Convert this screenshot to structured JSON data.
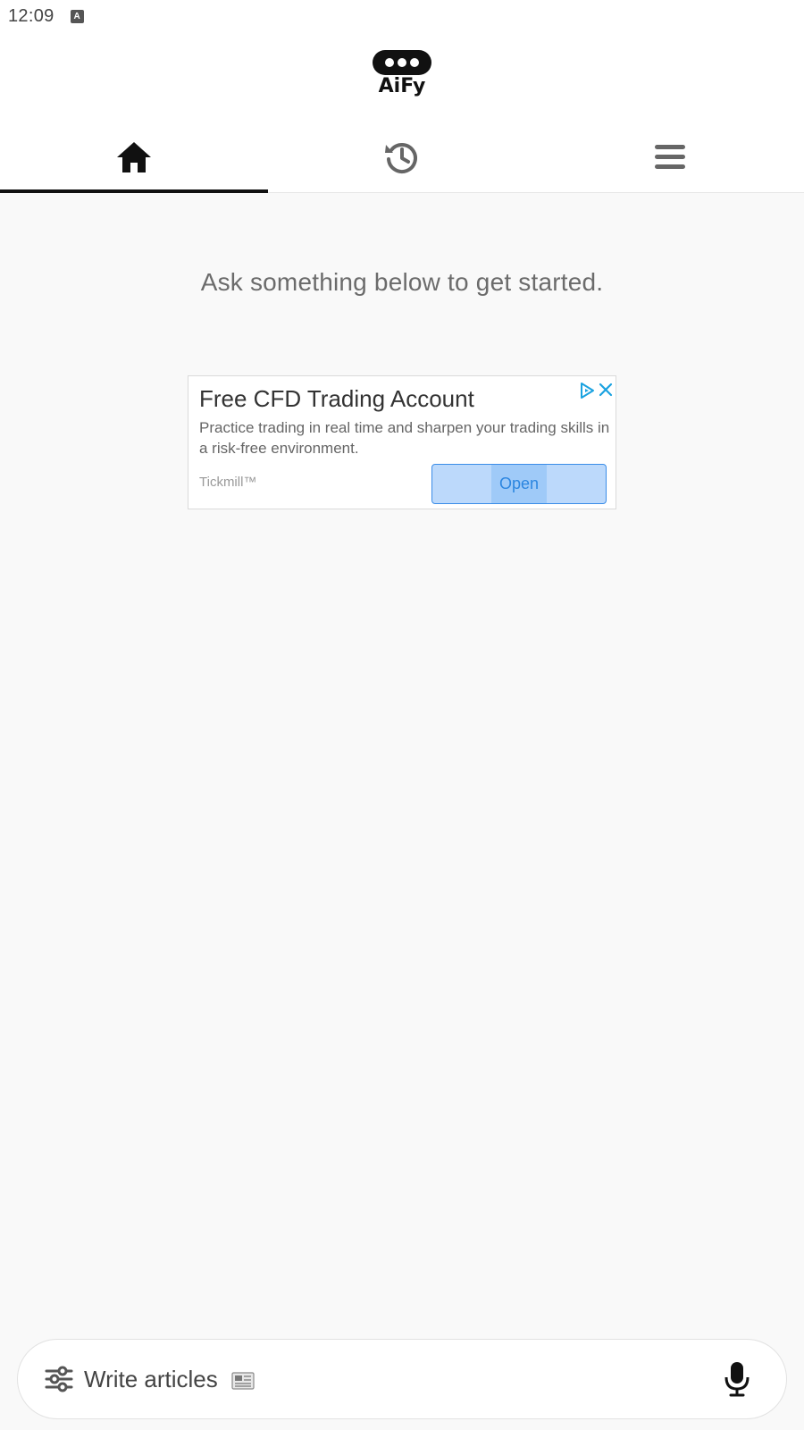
{
  "status_bar": {
    "time": "12:09",
    "notification_icon": "text-a-icon"
  },
  "header": {
    "logo_text": "AiFy",
    "tabs": [
      {
        "id": "home",
        "icon": "home-icon",
        "active": true
      },
      {
        "id": "history",
        "icon": "history-icon",
        "active": false
      },
      {
        "id": "menu",
        "icon": "menu-icon",
        "active": false
      }
    ]
  },
  "main": {
    "prompt": "Ask something below to get started."
  },
  "ad": {
    "title": "Free CFD Trading Account",
    "description": "Practice trading in real time and sharpen your trading skills in a risk-free environment.",
    "advertiser": "Tickmill™",
    "cta_label": "Open",
    "accent_color": "#2c86e0"
  },
  "input": {
    "placeholder": "Write articles",
    "filter_icon": "sliders-icon",
    "emoji_icon": "newspaper-icon",
    "mic_icon": "microphone-icon"
  }
}
